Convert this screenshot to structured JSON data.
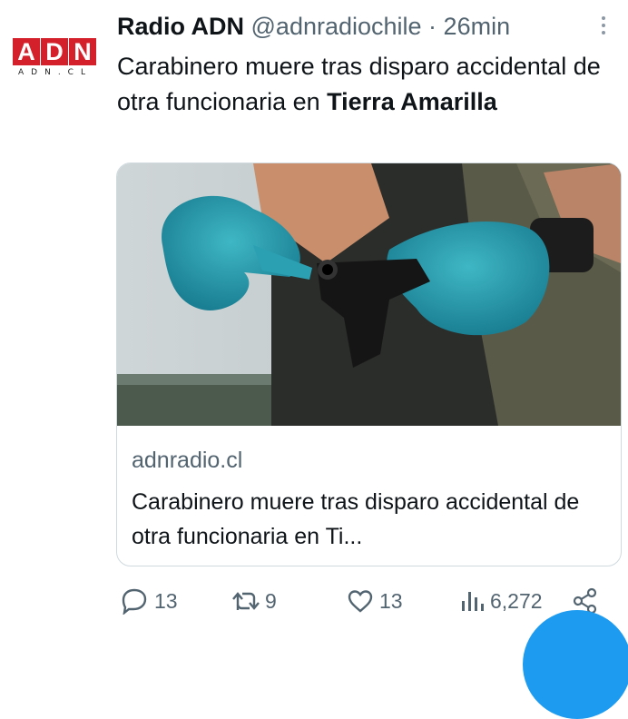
{
  "tweet": {
    "author_name": "Radio ADN",
    "handle": "@adnradiochile",
    "separator": " · ",
    "time": "26min",
    "text_main": "Carabinero muere tras disparo accidental de otra funcionaria en ",
    "text_bold": "Tierra Amarilla"
  },
  "avatar": {
    "logo_letters": [
      "A",
      "D",
      "N"
    ],
    "logo_subtitle": "ADN.CL"
  },
  "card": {
    "image_icon": "photo-gloved-hands-pistol",
    "domain": "adnradio.cl",
    "title": "Carabinero muere tras disparo accidental de otra funcionaria en Ti..."
  },
  "actions": {
    "reply_count": "13",
    "retweet_count": "9",
    "like_count": "13",
    "views_count": "6,272"
  },
  "colors": {
    "brand_red": "#d3202b",
    "secondary_text": "#536471",
    "accent_blue": "#1d9bf0"
  }
}
